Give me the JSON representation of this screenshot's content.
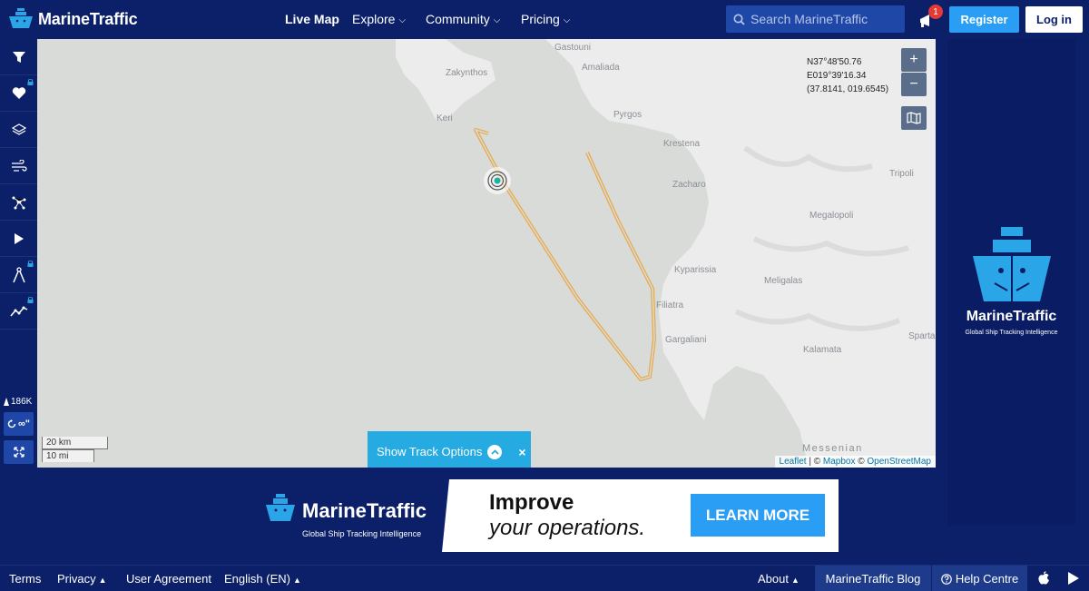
{
  "header": {
    "logo_text": "MarineTraffic",
    "nav": [
      {
        "label": "Live Map"
      },
      {
        "label": "Explore"
      },
      {
        "label": "Community"
      },
      {
        "label": "Pricing"
      }
    ],
    "search_placeholder": "Search MarineTraffic",
    "notification_count": "1",
    "register_label": "Register",
    "login_label": "Log in"
  },
  "sidebar": {
    "tools": [
      {
        "icon": "filter-icon"
      },
      {
        "icon": "heart-icon",
        "locked": true
      },
      {
        "icon": "layers-icon"
      },
      {
        "icon": "wind-icon"
      },
      {
        "icon": "network-icon"
      },
      {
        "icon": "play-icon"
      },
      {
        "icon": "compass-icon",
        "locked": true
      },
      {
        "icon": "chart-line-icon",
        "locked": true
      }
    ],
    "vessel_count": "186K",
    "timer_label": "∞\""
  },
  "map": {
    "coords": {
      "lat": "N37°48'50.76",
      "lon": "E019°39'16.34",
      "decimal": "(37.8141, 019.6545)"
    },
    "zoom_in": "+",
    "zoom_out": "−",
    "places": {
      "gastouni": "Gastouni",
      "zakynthos": "Zakynthos",
      "amaliada": "Amaliada",
      "keri": "Keri",
      "pyrgos": "Pyrgos",
      "krestena": "Krestena",
      "tripoli": "Tripoli",
      "zacharo": "Zacharo",
      "megalopoli": "Megalopoli",
      "kyparissia": "Kyparissia",
      "meligalas": "Meligalas",
      "filiatra": "Filiatra",
      "gargaliani": "Gargaliani",
      "sparta": "Sparta",
      "kalamata": "Kalamata",
      "messenian": "Messenian"
    },
    "scale_km": "20 km",
    "scale_mi": "10 mi",
    "attribution": {
      "leaflet": "Leaflet",
      "sep1": " | © ",
      "mapbox": "Mapbox",
      "sep2": " © ",
      "osm": "OpenStreetMap"
    },
    "track_options_label": "Show Track Options",
    "track_close": "×",
    "track_color": "#e8a94a"
  },
  "ad_right": {
    "brand": "MarineTraffic",
    "tagline": "Global Ship Tracking Intelligence"
  },
  "banner": {
    "brand": "MarineTraffic",
    "tagline": "Global Ship Tracking Intelligence",
    "headline1": "Improve",
    "headline2": "your operations.",
    "cta": "LEARN MORE"
  },
  "footer": {
    "terms": "Terms",
    "privacy": "Privacy",
    "user_agreement": "User Agreement",
    "language": "English (EN)",
    "about": "About",
    "blog": "MarineTraffic Blog",
    "help": "Help Centre"
  }
}
